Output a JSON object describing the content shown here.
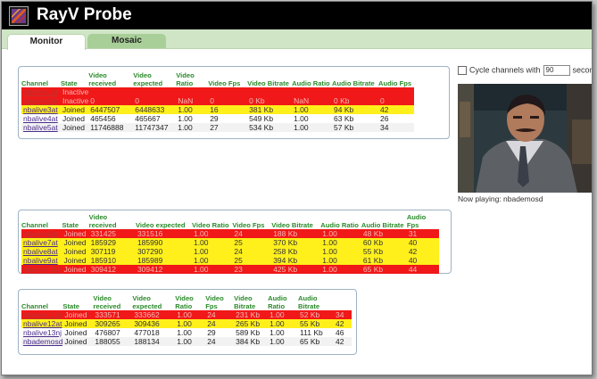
{
  "app": {
    "title": "RayV Probe"
  },
  "tabs": [
    {
      "label": "Monitor",
      "active": true
    },
    {
      "label": "Mosaic",
      "active": false
    }
  ],
  "sidebar": {
    "cycle_label": "Cycle channels with",
    "cycle_seconds": "90",
    "cycle_suffix": "seconds i",
    "now_playing": "Now playing: nbademosd"
  },
  "colors": {
    "inactive": "#f01818",
    "warning": "#fff01c",
    "header": "#2a8a2a",
    "titlebar": "#000000",
    "tabbar": "#cfe5c5"
  },
  "panel1": {
    "headers": [
      "Channel",
      "State",
      "Video received",
      "Video expected",
      "Video Ratio",
      "Video Fps",
      "Video Bitrate",
      "Audio Ratio",
      "Audio Bitrate",
      "Audio Fps"
    ],
    "rows": [
      {
        "status": "red",
        "cells": [
          "nbalive1at",
          "Inactive",
          "",
          "",
          "",
          "",
          "",
          "",
          "",
          ""
        ]
      },
      {
        "status": "red",
        "cells": [
          "nbalive2at",
          "Inactive",
          "0",
          "0",
          "NaN",
          "0",
          "0 Kb",
          "NaN",
          "0 Kb",
          "0"
        ]
      },
      {
        "status": "yellow",
        "cells": [
          "nbalive3at",
          "Joined",
          "6447507",
          "6448633",
          "1.00",
          "16",
          "381 Kb",
          "1.00",
          "94 Kb",
          "42"
        ]
      },
      {
        "status": "plain",
        "cells": [
          "nbalive4at",
          "Joined",
          "465456",
          "465667",
          "1.00",
          "29",
          "549 Kb",
          "1.00",
          "63 Kb",
          "26"
        ]
      },
      {
        "status": "gray",
        "cells": [
          "nbalive5at",
          "Joined",
          "11746888",
          "11747347",
          "1.00",
          "27",
          "534 Kb",
          "1.00",
          "57 Kb",
          "34"
        ]
      }
    ]
  },
  "panel2": {
    "headers": [
      "Channel",
      "State",
      "Video received",
      "Video expected",
      "Video Ratio",
      "Video Fps",
      "Video Bitrate",
      "Audio Ratio",
      "Audio Bitrate",
      "Audio Fps"
    ],
    "rows": [
      {
        "status": "red",
        "cells": [
          "nbalive6at",
          "Joined",
          "331425",
          "331516",
          "1.00",
          "24",
          "188 Kb",
          "1.00",
          "48 Kb",
          "31"
        ]
      },
      {
        "status": "yellow",
        "cells": [
          "nbalive7at",
          "Joined",
          "185929",
          "185990",
          "1.00",
          "25",
          "370 Kb",
          "1.00",
          "60 Kb",
          "40"
        ]
      },
      {
        "status": "yellow",
        "cells": [
          "nbalive8at",
          "Joined",
          "307119",
          "307290",
          "1.00",
          "24",
          "258 Kb",
          "1.00",
          "55 Kb",
          "42"
        ]
      },
      {
        "status": "yellow",
        "cells": [
          "nbalive9at",
          "Joined",
          "185910",
          "185989",
          "1.00",
          "25",
          "394 Kb",
          "1.00",
          "61 Kb",
          "40"
        ]
      },
      {
        "status": "red",
        "cells": [
          "nbalive10at",
          "Joined",
          "309412",
          "309412",
          "1.00",
          "23",
          "425 Kb",
          "1.00",
          "65 Kb",
          "44"
        ]
      }
    ]
  },
  "panel3": {
    "headers": [
      "Channel",
      "State",
      "Video received",
      "Video expected",
      "Video Ratio",
      "Video Fps",
      "Video Bitrate",
      "Audio Ratio",
      "Audio Bitrate",
      ""
    ],
    "rows": [
      {
        "status": "red",
        "cells": [
          "nbalive11at",
          "Joined",
          "333571",
          "333662",
          "1.00",
          "24",
          "231 Kb",
          "1.00",
          "52 Kb",
          "34"
        ]
      },
      {
        "status": "yellow",
        "cells": [
          "nbalive12at",
          "Joined",
          "309265",
          "309436",
          "1.00",
          "24",
          "265 Kb",
          "1.00",
          "55 Kb",
          "42"
        ]
      },
      {
        "status": "plain",
        "cells": [
          "nbalive13nj",
          "Joined",
          "476807",
          "477018",
          "1.00",
          "29",
          "589 Kb",
          "1.00",
          "111 Kb",
          "46"
        ]
      },
      {
        "status": "gray",
        "cells": [
          "nbademosd",
          "Joined",
          "188055",
          "188134",
          "1.00",
          "24",
          "384 Kb",
          "1.00",
          "65 Kb",
          "42"
        ]
      }
    ]
  }
}
